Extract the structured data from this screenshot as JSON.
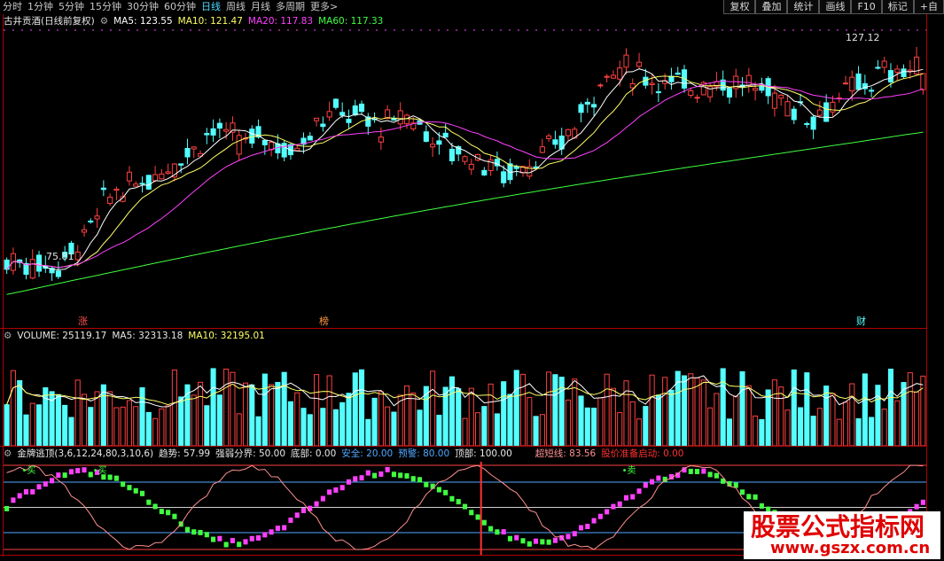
{
  "toolbar": {
    "periods": [
      "分时",
      "1分钟",
      "5分钟",
      "15分钟",
      "30分钟",
      "60分钟",
      "日线",
      "周线",
      "月线",
      "多周期",
      "更多>"
    ],
    "active_index": 6,
    "buttons": [
      "复权",
      "叠加",
      "统计",
      "画线",
      "F10",
      "标记",
      "+自"
    ]
  },
  "price_panel": {
    "title": "古井贡酒(日线前复权)",
    "ma5": "MA5: 123.55",
    "ma10": "MA10: 121.47",
    "ma20": "MA20: 117.83",
    "ma60": "MA60: 117.33",
    "high_label": "127.12",
    "low_label": "75.81",
    "markers": [
      "涨",
      "榜",
      "财"
    ]
  },
  "volume_panel": {
    "volume": "VOLUME: 25119.17",
    "ma5": "MA5: 32313.18",
    "ma10": "MA10: 32195.01"
  },
  "indicator_panel": {
    "name": "金牌逃顶(3,6,12,24,80,3,10,6)",
    "trend": "趋势: 57.99",
    "divide": "强弱分界: 50.00",
    "bottom": "底部: 0.00",
    "safe": "安全: 20.00",
    "warn": "预警: 80.00",
    "top": "顶部: 100.00",
    "super_short": "超短线: 83.56",
    "launch": "股价准备启动: 0.00",
    "buy_label": "买",
    "sell_label": "卖"
  },
  "logo": {
    "line1": "股票公式指标网",
    "line2": "www.gszx.com.cn"
  },
  "colors": {
    "up": "#ff4040",
    "down": "#54ffff",
    "ma5": "#ffffff",
    "ma10": "#ffff66",
    "ma20": "#ff40ff",
    "ma60": "#40ff40",
    "frame": "#b00000"
  }
}
